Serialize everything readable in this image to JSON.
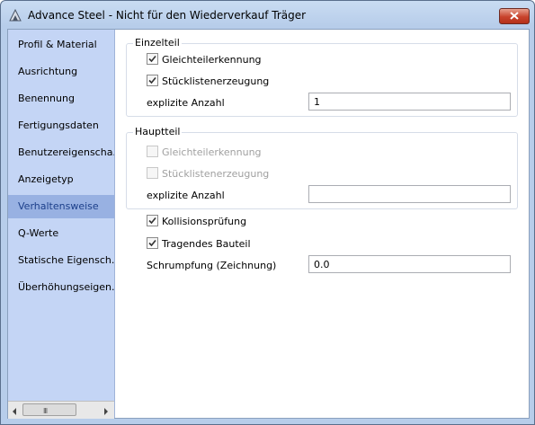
{
  "window": {
    "title": "Advance Steel - Nicht für den Wiederverkauf  Träger"
  },
  "sidebar": {
    "items": [
      {
        "label": "Profil & Material",
        "active": false
      },
      {
        "label": "Ausrichtung",
        "active": false
      },
      {
        "label": "Benennung",
        "active": false
      },
      {
        "label": "Fertigungsdaten",
        "active": false
      },
      {
        "label": "Benutzereigenscha...",
        "active": false
      },
      {
        "label": "Anzeigetyp",
        "active": false
      },
      {
        "label": "Verhaltensweise",
        "active": true
      },
      {
        "label": "Q-Werte",
        "active": false
      },
      {
        "label": "Statische Eigensch...",
        "active": false
      },
      {
        "label": "Überhöhungseigen...",
        "active": false
      }
    ],
    "scrollbar_grip": "III"
  },
  "einzelteil": {
    "legend": "Einzelteil",
    "gleichteil": {
      "label": "Gleichteilerkennung",
      "checked": true,
      "enabled": true
    },
    "stueckliste": {
      "label": "Stücklistenerzeugung",
      "checked": true,
      "enabled": true
    },
    "anzahl_label": "explizite Anzahl",
    "anzahl_value": "1"
  },
  "hauptteil": {
    "legend": "Hauptteil",
    "gleichteil": {
      "label": "Gleichteilerkennung",
      "checked": false,
      "enabled": false
    },
    "stueckliste": {
      "label": "Stücklistenerzeugung",
      "checked": false,
      "enabled": false
    },
    "anzahl_label": "explizite Anzahl",
    "anzahl_value": ""
  },
  "kollision": {
    "label": "Kollisionsprüfung",
    "checked": true
  },
  "tragend": {
    "label": "Tragendes Bauteil",
    "checked": true
  },
  "schrumpfung": {
    "label": "Schrumpfung (Zeichnung)",
    "value": "0.0"
  },
  "colors": {
    "sidebar_bg": "#c4d5f5",
    "sidebar_active": "#98b1e2",
    "titlebar": "#b7cdea",
    "close_button": "#c8432c"
  }
}
